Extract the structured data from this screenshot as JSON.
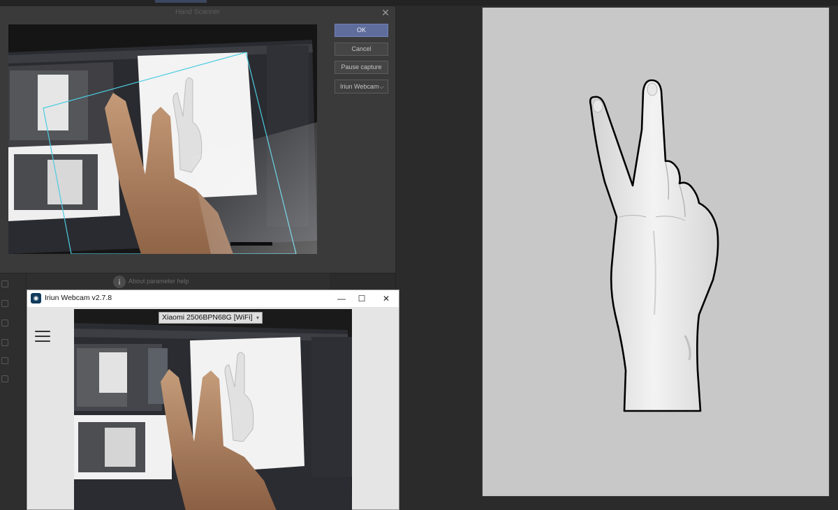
{
  "background": {
    "help_label": "About parameter help"
  },
  "scanner": {
    "title": "Hand Scanner",
    "ok_label": "OK",
    "cancel_label": "Cancel",
    "pause_label": "Pause capture",
    "camera_source": "Iriun Webcam"
  },
  "iriun": {
    "title": "Iriun Webcam v2.7.8",
    "device": "Xiaomi 2506BPN68G [WiFi]"
  },
  "icons": [
    "close-icon",
    "chevron-down-icon",
    "help-icon",
    "minimize-icon",
    "maximize-icon",
    "menu-icon",
    "webcam-app-icon"
  ],
  "colors": {
    "accent": "#5f6d9c",
    "tracking_frame": "#4ccce0",
    "viewport_bg": "#c8c8c8"
  }
}
